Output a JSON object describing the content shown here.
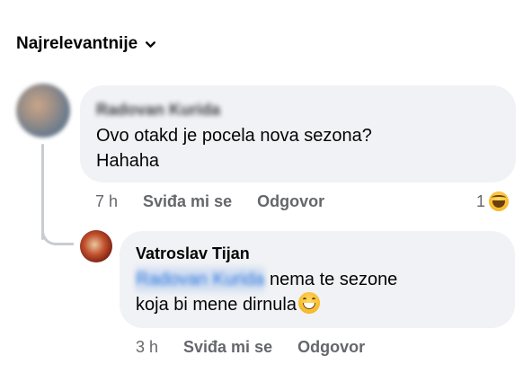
{
  "sort": {
    "label": "Najrelevantnije"
  },
  "comments": [
    {
      "author": "Radovan Kurida",
      "text": "Ovo otakd je pocela nova sezona?\nHahaha",
      "time": "7 h",
      "like_label": "Sviđa mi se",
      "reply_label": "Odgovor",
      "reaction_count": "1",
      "reaction_icon": "haha-emoji-icon"
    },
    {
      "author": "Vatroslav Tijan",
      "mention": "Radovan Kurida",
      "text_line1": " nema te sezone",
      "text_line2": "koja bi mene dirnula",
      "emoji_icon": "grinning-emoji-icon",
      "time": "3 h",
      "like_label": "Sviđa mi se",
      "reply_label": "Odgovor"
    }
  ],
  "colors": {
    "bubble": "#f0f2f5",
    "meta_text": "#65676b",
    "mention": "#216fdb",
    "thread_line": "#c9ccd1"
  }
}
